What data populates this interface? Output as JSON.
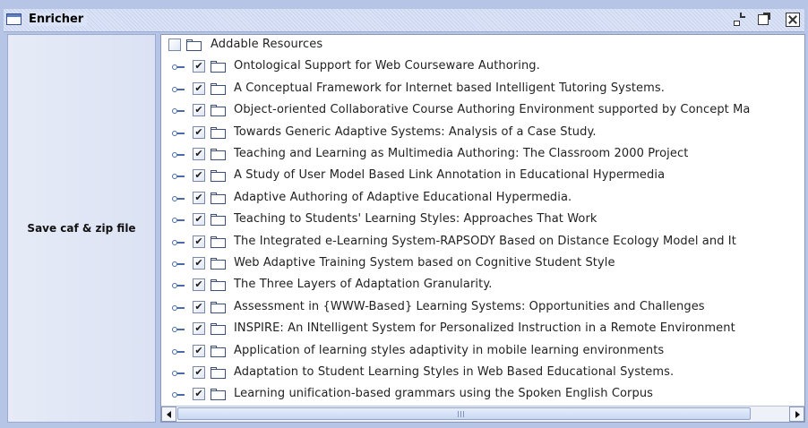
{
  "window": {
    "title": "Enricher",
    "controls": [
      "iconify-icon",
      "maximize-icon",
      "close-icon"
    ]
  },
  "left_panel": {
    "save_button_label": "Save caf & zip file"
  },
  "tree": {
    "root": {
      "label": "Addable Resources",
      "checked": false,
      "icon": "folder-icon"
    },
    "items": [
      {
        "label": "Ontological Support for Web Courseware Authoring.",
        "checked": true
      },
      {
        "label": "A Conceptual Framework for Internet based Intelligent Tutoring Systems.",
        "checked": true
      },
      {
        "label": "Object-oriented Collaborative Course Authoring Environment supported by Concept Ma",
        "checked": true
      },
      {
        "label": "Towards Generic Adaptive Systems: Analysis of a Case Study.",
        "checked": true
      },
      {
        "label": "Teaching and Learning as Multimedia Authoring: The Classroom 2000 Project",
        "checked": true
      },
      {
        "label": "A Study of User Model Based Link Annotation in Educational Hypermedia",
        "checked": true
      },
      {
        "label": "Adaptive Authoring of Adaptive Educational Hypermedia.",
        "checked": true
      },
      {
        "label": "Teaching to Students' Learning Styles: Approaches That Work",
        "checked": true
      },
      {
        "label": "The Integrated e-Learning System-RAPSODY Based on Distance Ecology Model and It",
        "checked": true
      },
      {
        "label": "Web Adaptive Training System based on Cognitive Student Style",
        "checked": true
      },
      {
        "label": "The Three Layers of Adaptation Granularity.",
        "checked": true
      },
      {
        "label": "Assessment in {WWW-Based} Learning Systems: Opportunities and Challenges",
        "checked": true
      },
      {
        "label": "INSPIRE: An INtelligent System for Personalized Instruction in a Remote Environment",
        "checked": true
      },
      {
        "label": "Application of learning styles adaptivity in mobile learning environments",
        "checked": true
      },
      {
        "label": "Adaptation to Student Learning Styles in Web Based Educational Systems.",
        "checked": true
      },
      {
        "label": "Learning unification-based grammars using the Spoken English Corpus",
        "checked": true
      }
    ]
  },
  "scrollbar": {
    "horizontal_position": 0,
    "grip_label": "III"
  }
}
